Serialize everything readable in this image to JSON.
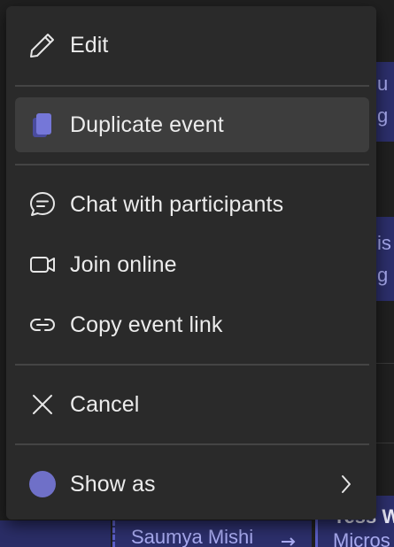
{
  "menu": {
    "items": [
      {
        "label": "Edit",
        "icon": "pencil-icon"
      },
      {
        "label": "Duplicate event",
        "icon": "duplicate-icon"
      },
      {
        "label": "Chat with participants",
        "icon": "chat-icon"
      },
      {
        "label": "Join online",
        "icon": "video-camera-icon"
      },
      {
        "label": "Copy event link",
        "icon": "link-icon"
      },
      {
        "label": "Cancel",
        "icon": "close-icon"
      },
      {
        "label": "Show as",
        "icon": "status-dot-icon"
      }
    ]
  },
  "background": {
    "event_snippets": [
      "u",
      "g",
      "is",
      "g",
      "Saumya Mishi",
      "ress W",
      "Micros"
    ]
  },
  "colors": {
    "menu_bg": "#2a2a2a",
    "hover_bg": "#3d3d3d",
    "accent": "#6264a7",
    "status_dot": "#6f70c8",
    "text": "#ececec"
  }
}
